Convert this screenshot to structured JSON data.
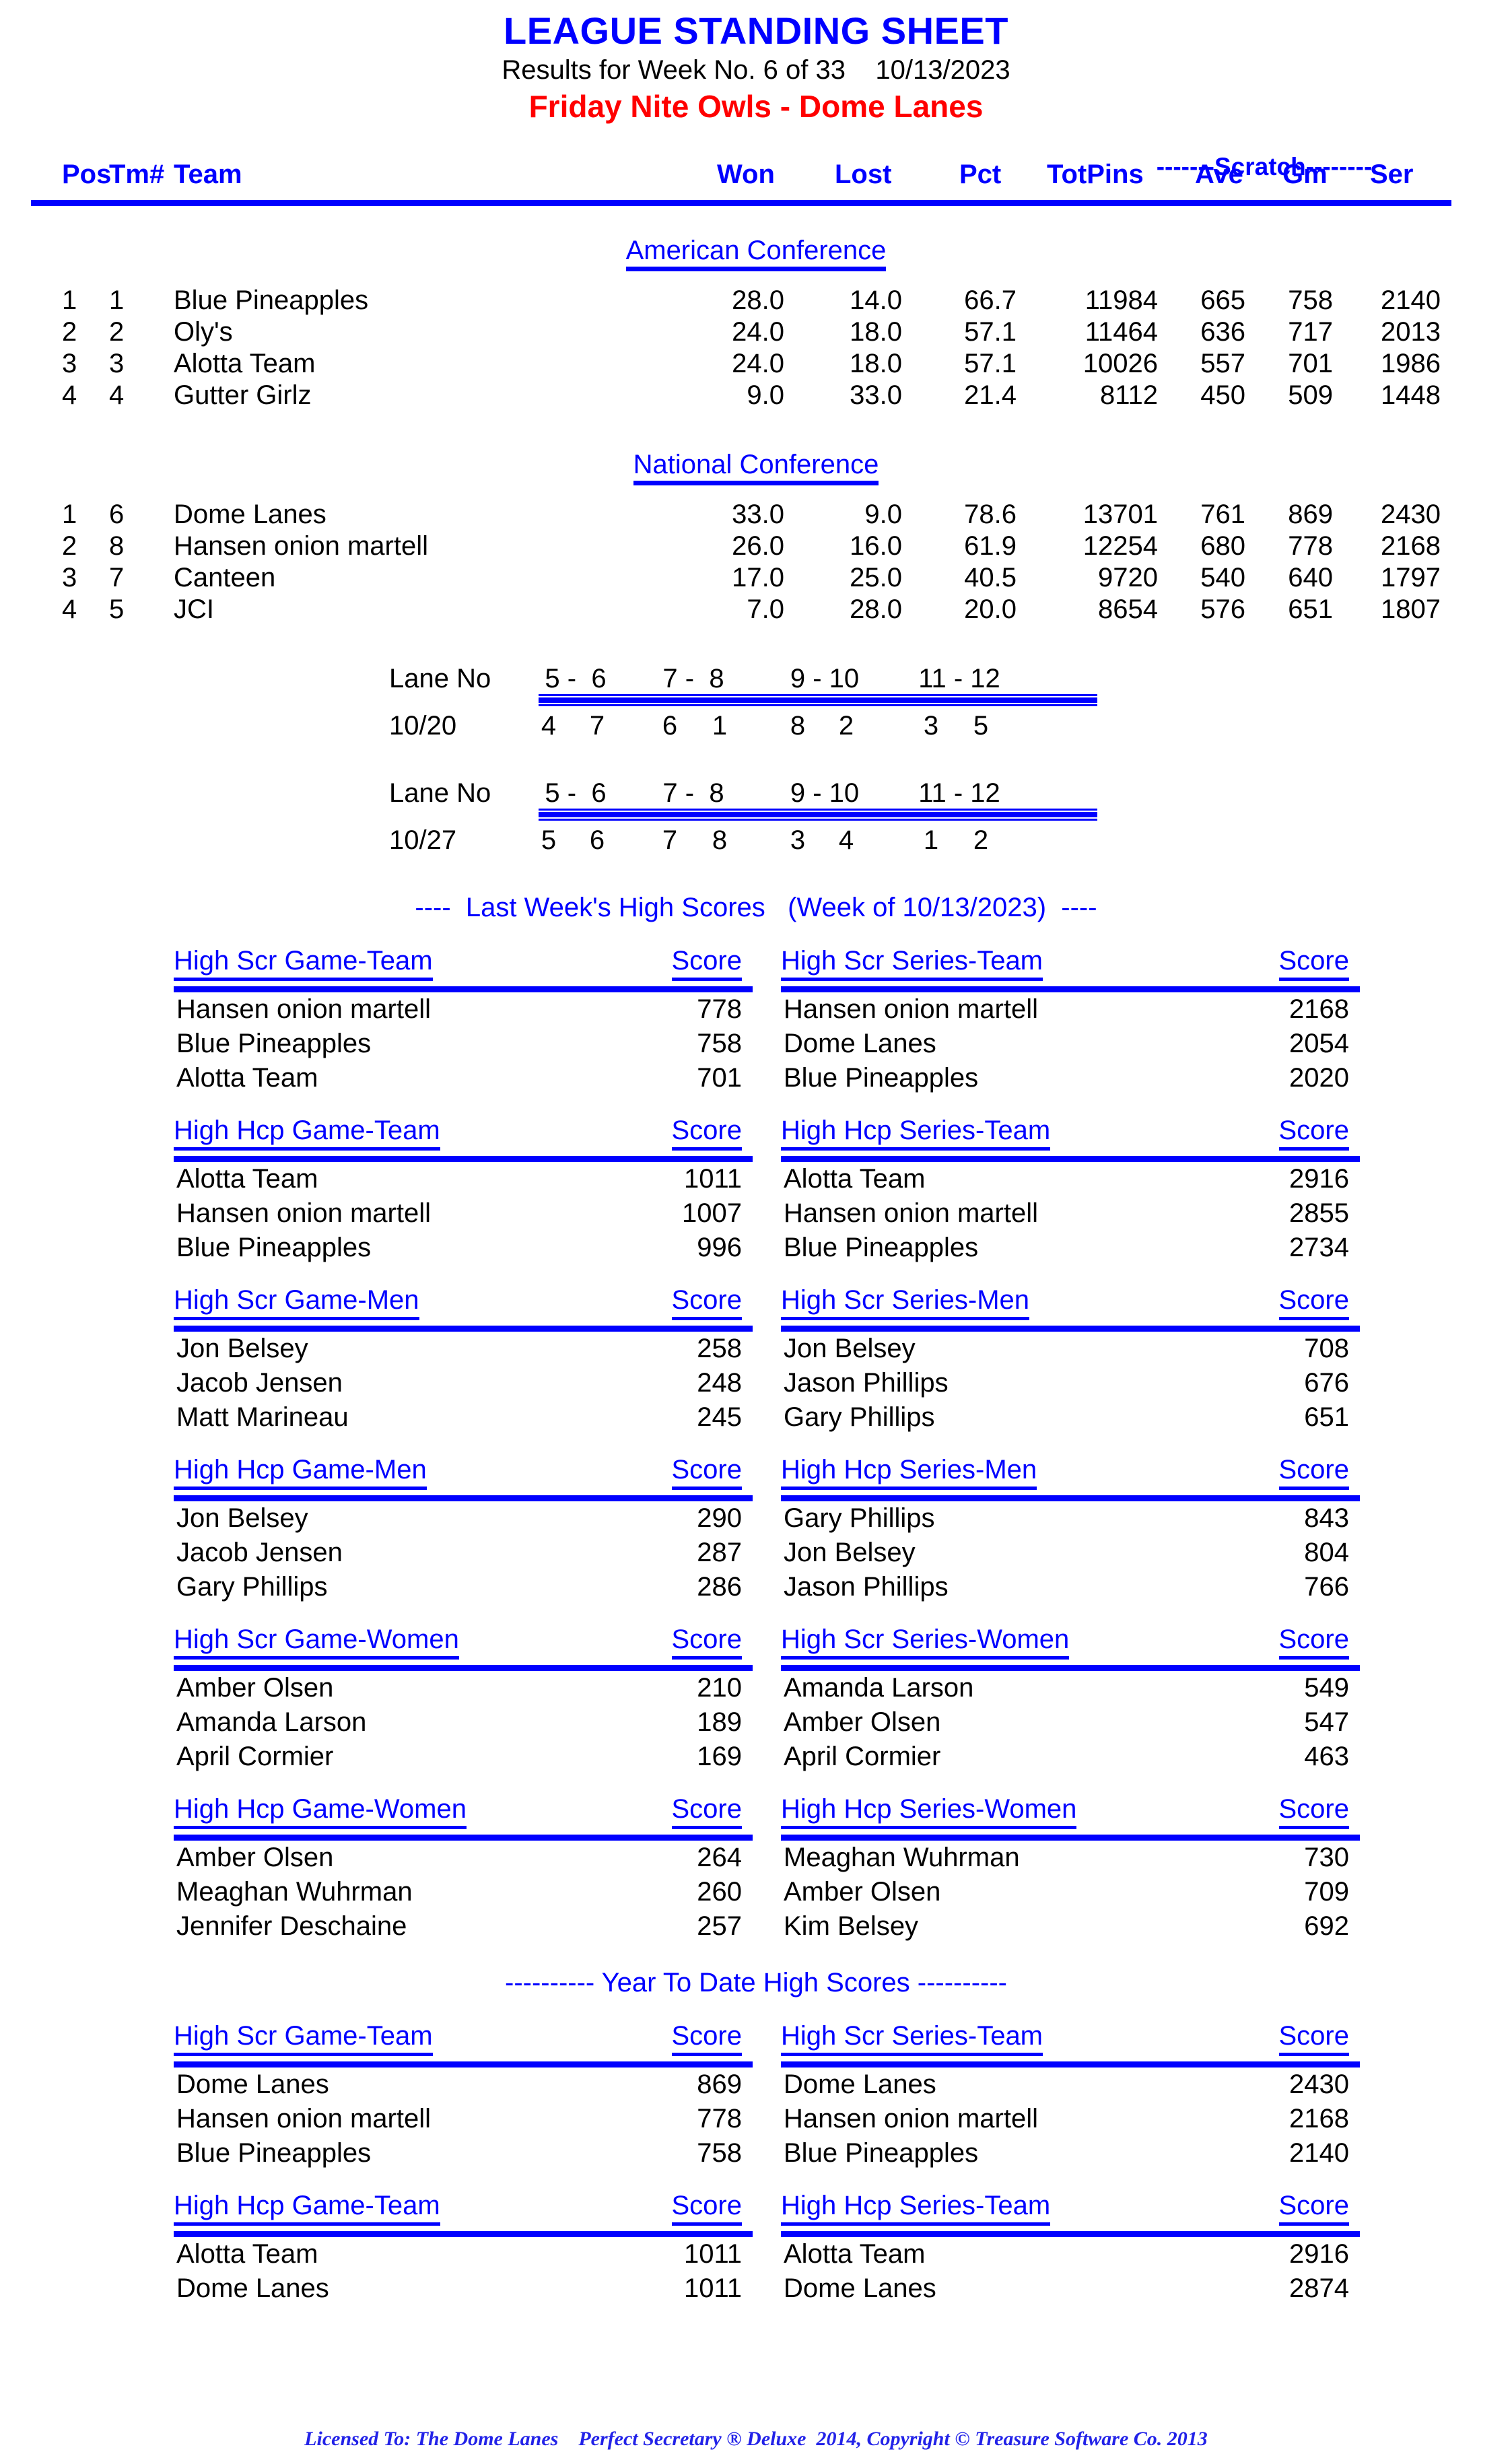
{
  "header": {
    "title": "LEAGUE STANDING SHEET",
    "subtitle": "Results for Week No. 6 of 33    10/13/2023",
    "league": "Friday Nite Owls - Dome Lanes"
  },
  "colors": {
    "accent_blue": "#0000FF",
    "league_red": "#FF0000",
    "text_black": "#000000"
  },
  "standings": {
    "scratch_label": "-------Scratch--------",
    "columns": {
      "pos": "Pos",
      "tm": "Tm#",
      "team": "Team",
      "won": "Won",
      "lost": "Lost",
      "pct": "Pct",
      "totpins": "TotPins",
      "ave": "Ave",
      "gm": "Gm",
      "ser": "Ser"
    },
    "conferences": [
      {
        "name": "American Conference",
        "rows": [
          {
            "pos": "1",
            "tm": "1",
            "team": "Blue Pineapples",
            "won": "28.0",
            "lost": "14.0",
            "pct": "66.7",
            "totpins": "11984",
            "ave": "665",
            "gm": "758",
            "ser": "2140"
          },
          {
            "pos": "2",
            "tm": "2",
            "team": "Oly's",
            "won": "24.0",
            "lost": "18.0",
            "pct": "57.1",
            "totpins": "11464",
            "ave": "636",
            "gm": "717",
            "ser": "2013"
          },
          {
            "pos": "3",
            "tm": "3",
            "team": "Alotta Team",
            "won": "24.0",
            "lost": "18.0",
            "pct": "57.1",
            "totpins": "10026",
            "ave": "557",
            "gm": "701",
            "ser": "1986"
          },
          {
            "pos": "4",
            "tm": "4",
            "team": "Gutter Girlz",
            "won": "9.0",
            "lost": "33.0",
            "pct": "21.4",
            "totpins": "8112",
            "ave": "450",
            "gm": "509",
            "ser": "1448"
          }
        ]
      },
      {
        "name": "National Conference",
        "rows": [
          {
            "pos": "1",
            "tm": "6",
            "team": "Dome Lanes",
            "won": "33.0",
            "lost": "9.0",
            "pct": "78.6",
            "totpins": "13701",
            "ave": "761",
            "gm": "869",
            "ser": "2430"
          },
          {
            "pos": "2",
            "tm": "8",
            "team": "Hansen onion martell",
            "won": "26.0",
            "lost": "16.0",
            "pct": "61.9",
            "totpins": "12254",
            "ave": "680",
            "gm": "778",
            "ser": "2168"
          },
          {
            "pos": "3",
            "tm": "7",
            "team": "Canteen",
            "won": "17.0",
            "lost": "25.0",
            "pct": "40.5",
            "totpins": "9720",
            "ave": "540",
            "gm": "640",
            "ser": "1797"
          },
          {
            "pos": "4",
            "tm": "5",
            "team": "JCI",
            "won": "7.0",
            "lost": "28.0",
            "pct": "20.0",
            "totpins": "8654",
            "ave": "576",
            "gm": "651",
            "ser": "1807"
          }
        ]
      }
    ]
  },
  "lane_schedule": {
    "label": "Lane No",
    "pairs": [
      "5 -  6",
      "7 -  8",
      "9 - 10",
      "11 - 12"
    ],
    "weeks": [
      {
        "date": "10/20",
        "teams": [
          "4",
          "7",
          "6",
          "1",
          "8",
          "2",
          "3",
          "5"
        ]
      },
      {
        "date": "10/27",
        "teams": [
          "5",
          "6",
          "7",
          "8",
          "3",
          "4",
          "1",
          "2"
        ]
      }
    ]
  },
  "last_week": {
    "banner": "----  Last Week's High Scores   (Week of 10/13/2023)  ----",
    "score_label": "Score",
    "sections": [
      {
        "title": "High Scr Game-Team",
        "rows": [
          {
            "name": "Hansen onion martell",
            "score": "778"
          },
          {
            "name": "Blue Pineapples",
            "score": "758"
          },
          {
            "name": "Alotta Team",
            "score": "701"
          }
        ]
      },
      {
        "title": "High Scr Series-Team",
        "rows": [
          {
            "name": "Hansen onion martell",
            "score": "2168"
          },
          {
            "name": "Dome Lanes",
            "score": "2054"
          },
          {
            "name": "Blue Pineapples",
            "score": "2020"
          }
        ]
      },
      {
        "title": "High Hcp Game-Team",
        "rows": [
          {
            "name": "Alotta Team",
            "score": "1011"
          },
          {
            "name": "Hansen onion martell",
            "score": "1007"
          },
          {
            "name": "Blue Pineapples",
            "score": "996"
          }
        ]
      },
      {
        "title": "High Hcp Series-Team",
        "rows": [
          {
            "name": "Alotta Team",
            "score": "2916"
          },
          {
            "name": "Hansen onion martell",
            "score": "2855"
          },
          {
            "name": "Blue Pineapples",
            "score": "2734"
          }
        ]
      },
      {
        "title": "High Scr Game-Men",
        "rows": [
          {
            "name": "Jon Belsey",
            "score": "258"
          },
          {
            "name": "Jacob Jensen",
            "score": "248"
          },
          {
            "name": "Matt Marineau",
            "score": "245"
          }
        ]
      },
      {
        "title": "High Scr Series-Men",
        "rows": [
          {
            "name": "Jon Belsey",
            "score": "708"
          },
          {
            "name": "Jason Phillips",
            "score": "676"
          },
          {
            "name": "Gary Phillips",
            "score": "651"
          }
        ]
      },
      {
        "title": "High Hcp Game-Men",
        "rows": [
          {
            "name": "Jon Belsey",
            "score": "290"
          },
          {
            "name": "Jacob Jensen",
            "score": "287"
          },
          {
            "name": "Gary Phillips",
            "score": "286"
          }
        ]
      },
      {
        "title": "High Hcp Series-Men",
        "rows": [
          {
            "name": "Gary Phillips",
            "score": "843"
          },
          {
            "name": "Jon Belsey",
            "score": "804"
          },
          {
            "name": "Jason Phillips",
            "score": "766"
          }
        ]
      },
      {
        "title": "High Scr Game-Women",
        "rows": [
          {
            "name": "Amber Olsen",
            "score": "210"
          },
          {
            "name": "Amanda Larson",
            "score": "189"
          },
          {
            "name": "April Cormier",
            "score": "169"
          }
        ]
      },
      {
        "title": "High Scr Series-Women",
        "rows": [
          {
            "name": "Amanda Larson",
            "score": "549"
          },
          {
            "name": "Amber Olsen",
            "score": "547"
          },
          {
            "name": "April Cormier",
            "score": "463"
          }
        ]
      },
      {
        "title": "High Hcp Game-Women",
        "rows": [
          {
            "name": "Amber Olsen",
            "score": "264"
          },
          {
            "name": "Meaghan Wuhrman",
            "score": "260"
          },
          {
            "name": "Jennifer Deschaine",
            "score": "257"
          }
        ]
      },
      {
        "title": "High Hcp Series-Women",
        "rows": [
          {
            "name": "Meaghan Wuhrman",
            "score": "730"
          },
          {
            "name": "Amber Olsen",
            "score": "709"
          },
          {
            "name": "Kim Belsey",
            "score": "692"
          }
        ]
      }
    ]
  },
  "year_to_date": {
    "banner": "---------- Year To Date High Scores ----------",
    "score_label": "Score",
    "sections": [
      {
        "title": "High Scr Game-Team",
        "rows": [
          {
            "name": "Dome Lanes",
            "score": "869"
          },
          {
            "name": "Hansen onion martell",
            "score": "778"
          },
          {
            "name": "Blue Pineapples",
            "score": "758"
          }
        ]
      },
      {
        "title": "High Scr Series-Team",
        "rows": [
          {
            "name": "Dome Lanes",
            "score": "2430"
          },
          {
            "name": "Hansen onion martell",
            "score": "2168"
          },
          {
            "name": "Blue Pineapples",
            "score": "2140"
          }
        ]
      },
      {
        "title": "High Hcp Game-Team",
        "rows": [
          {
            "name": "Alotta Team",
            "score": "1011"
          },
          {
            "name": "Dome Lanes",
            "score": "1011"
          }
        ]
      },
      {
        "title": "High Hcp Series-Team",
        "rows": [
          {
            "name": "Alotta Team",
            "score": "2916"
          },
          {
            "name": "Dome Lanes",
            "score": "2874"
          }
        ]
      }
    ]
  },
  "footer": {
    "text": "Licensed To: The Dome Lanes    Perfect Secretary ® Deluxe  2014, Copyright © Treasure Software Co. 2013"
  }
}
